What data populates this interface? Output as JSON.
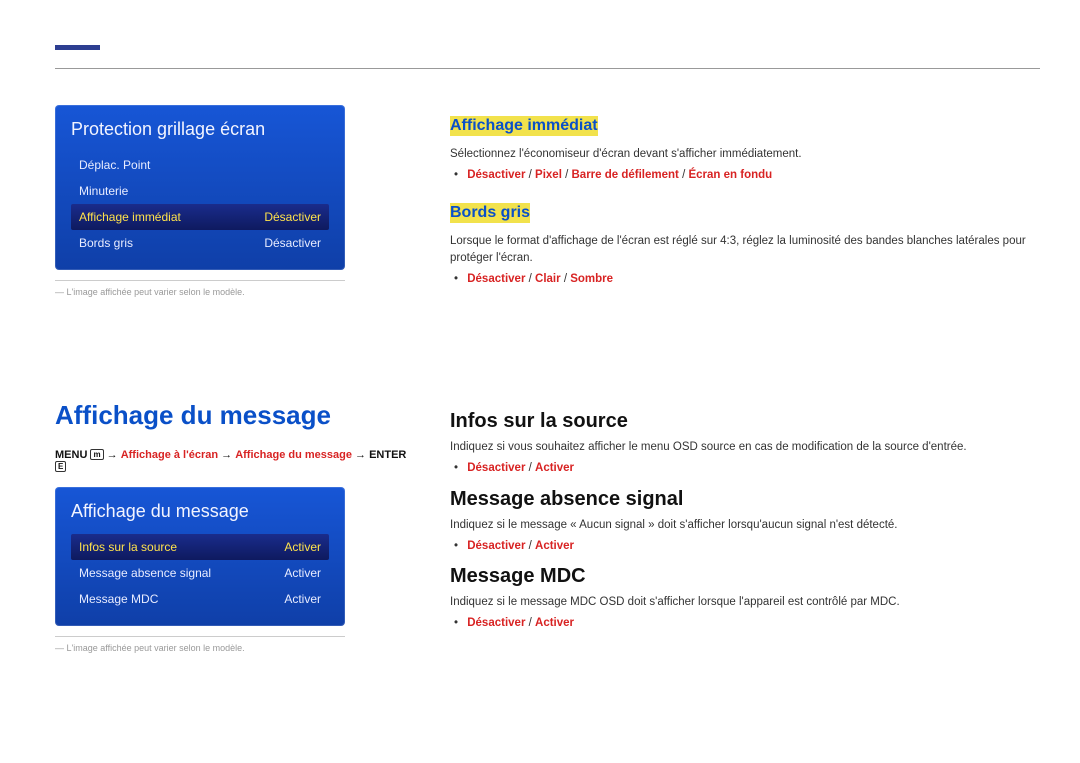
{
  "top_panel": {
    "title": "Protection grillage écran",
    "rows": [
      {
        "label": "Déplac. Point",
        "value": ""
      },
      {
        "label": "Minuterie",
        "value": ""
      },
      {
        "label": "Affichage immédiat",
        "value": "Désactiver",
        "selected": true
      },
      {
        "label": "Bords gris",
        "value": "Désactiver"
      }
    ]
  },
  "footnote1": "L'image affichée peut varier selon le modèle.",
  "sec_immediat": {
    "heading": "Affichage immédiat",
    "desc": "Sélectionnez l'économiseur d'écran devant s'afficher immédiatement.",
    "options": [
      "Désactiver",
      "Pixel",
      "Barre de défilement",
      "Écran en fondu"
    ]
  },
  "sec_bords": {
    "heading": "Bords gris",
    "desc": "Lorsque le format d'affichage de l'écran est réglé sur 4:3, réglez la luminosité des bandes blanches latérales pour protéger l'écran.",
    "options": [
      "Désactiver",
      "Clair",
      "Sombre"
    ]
  },
  "main_heading": "Affichage du message",
  "breadcrumb": {
    "menu_label": "MENU",
    "menu_icon": "m",
    "p1": "Affichage à l'écran",
    "p2": "Affichage du message",
    "enter_label": "ENTER",
    "enter_icon": "E",
    "arrow": " → "
  },
  "msg_panel": {
    "title": "Affichage du message",
    "rows": [
      {
        "label": "Infos sur la source",
        "value": "Activer",
        "selected": true
      },
      {
        "label": "Message absence signal",
        "value": "Activer"
      },
      {
        "label": "Message MDC",
        "value": "Activer"
      }
    ]
  },
  "footnote2": "L'image affichée peut varier selon le modèle.",
  "sec_infos": {
    "heading": "Infos sur la source",
    "desc": "Indiquez si vous souhaitez afficher le menu OSD source en cas de modification de la source d'entrée.",
    "options": [
      "Désactiver",
      "Activer"
    ]
  },
  "sec_abs": {
    "heading": "Message absence signal",
    "desc": "Indiquez si le message « Aucun signal » doit s'afficher lorsqu'aucun signal n'est détecté.",
    "options": [
      "Désactiver",
      "Activer"
    ]
  },
  "sec_mdc": {
    "heading": "Message MDC",
    "desc": "Indiquez si le message MDC OSD doit s'afficher lorsque l'appareil est contrôlé par MDC.",
    "options": [
      "Désactiver",
      "Activer"
    ]
  }
}
